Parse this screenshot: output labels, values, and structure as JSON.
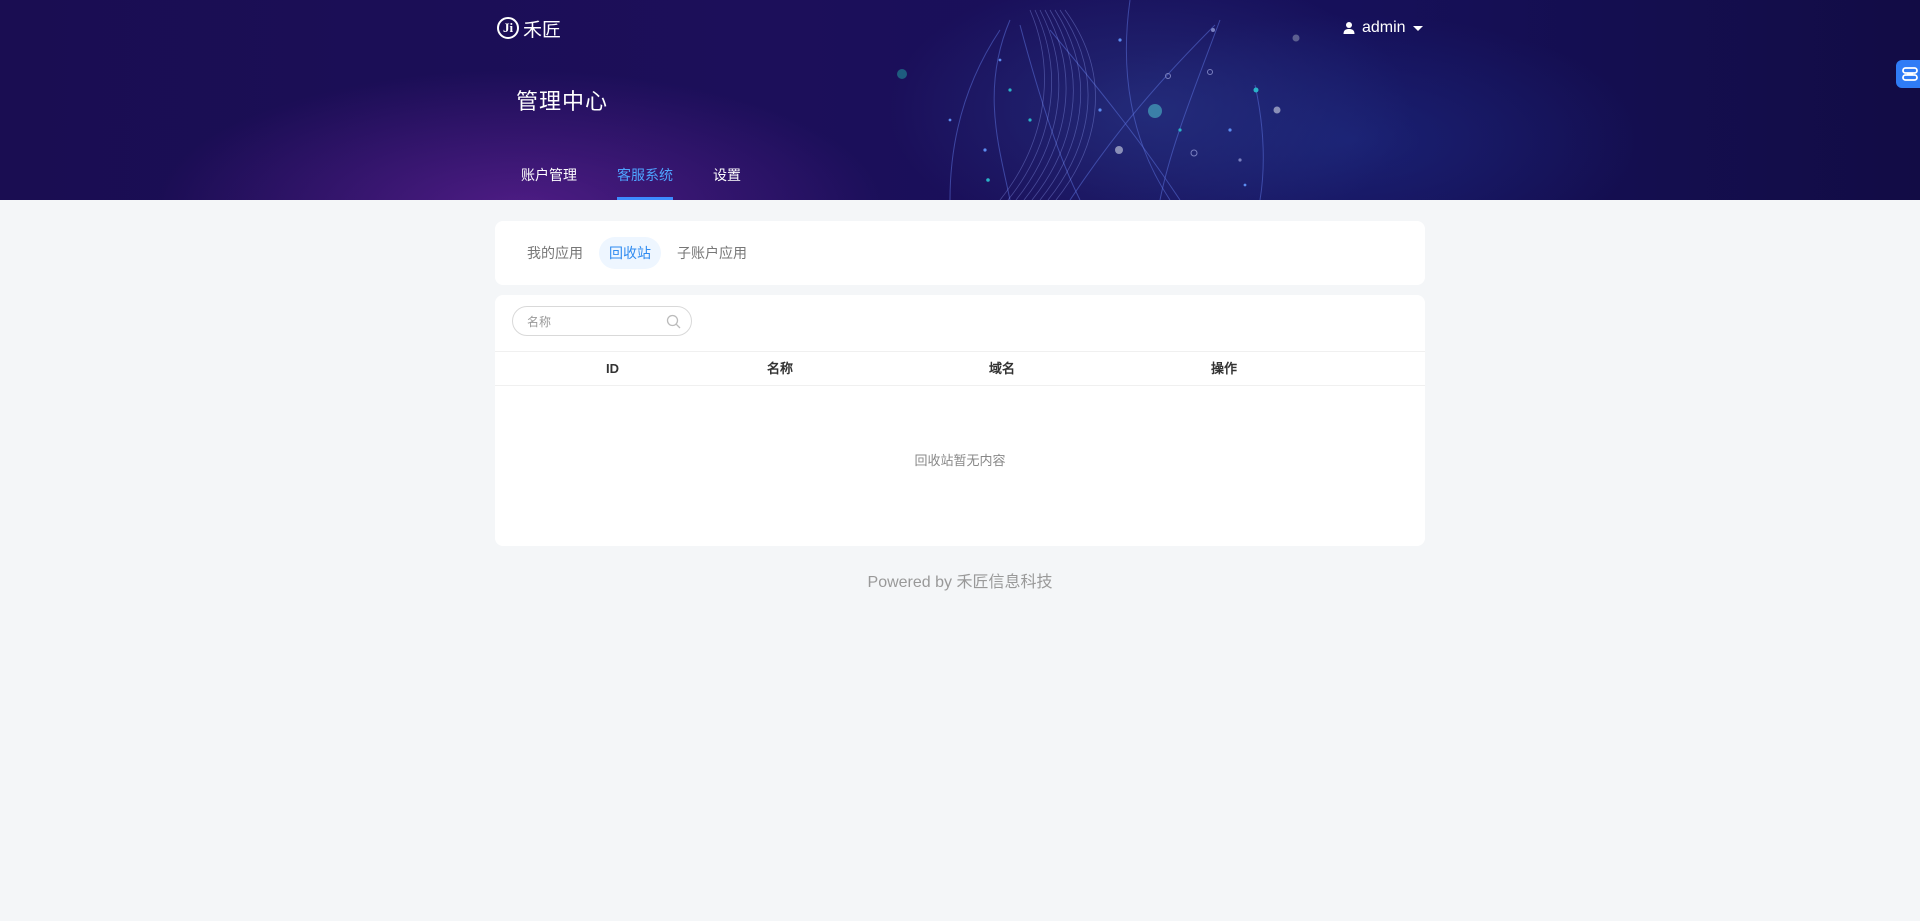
{
  "header": {
    "logo_text": "禾匠",
    "logo_mark": "Ji",
    "user_name": "admin",
    "page_title": "管理中心",
    "tabs": [
      {
        "label": "账户管理",
        "active": false
      },
      {
        "label": "客服系统",
        "active": true
      },
      {
        "label": "设置",
        "active": false
      }
    ]
  },
  "subtabs": [
    {
      "label": "我的应用",
      "active": false
    },
    {
      "label": "回收站",
      "active": true
    },
    {
      "label": "子账户应用",
      "active": false
    }
  ],
  "search": {
    "placeholder": "名称",
    "value": ""
  },
  "table": {
    "columns": [
      "ID",
      "名称",
      "域名",
      "操作"
    ],
    "rows": [],
    "empty_text": "回收站暂无内容"
  },
  "footer": {
    "text": "Powered by 禾匠信息科技"
  },
  "colors": {
    "accent": "#2f8bf0",
    "header_bg": "#1c0f5a",
    "page_bg": "#f4f6f8"
  },
  "icons": {
    "user": "user-icon",
    "caret": "caret-down-icon",
    "search": "search-icon",
    "float": "link-icon"
  }
}
